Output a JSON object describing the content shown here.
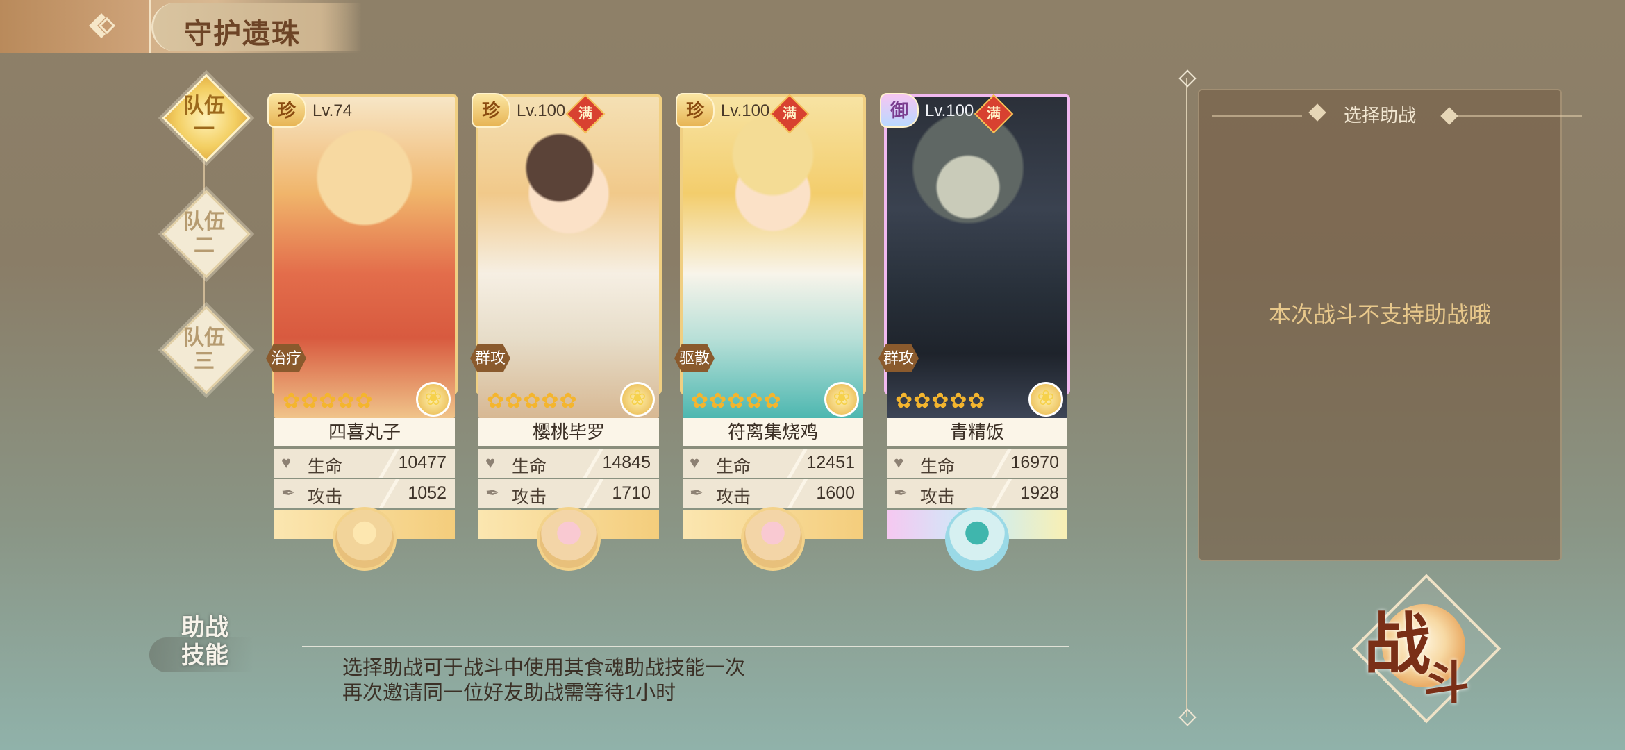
{
  "header": {
    "title": "守护遗珠"
  },
  "teams": [
    {
      "line1": "队伍",
      "line2": "一",
      "active": true
    },
    {
      "line1": "队伍",
      "line2": "二",
      "active": false
    },
    {
      "line1": "队伍",
      "line2": "三",
      "active": false
    }
  ],
  "cards": [
    {
      "rarity": "珍",
      "level": "Lv.74",
      "max_badge": "",
      "role": "治疗",
      "name": "四喜丸子",
      "hp_label": "生命",
      "hp": "10477",
      "atk_label": "攻击",
      "atk": "1052"
    },
    {
      "rarity": "珍",
      "level": "Lv.100",
      "max_badge": "满",
      "role": "群攻",
      "name": "樱桃毕罗",
      "hp_label": "生命",
      "hp": "14845",
      "atk_label": "攻击",
      "atk": "1710"
    },
    {
      "rarity": "珍",
      "level": "Lv.100",
      "max_badge": "满",
      "role": "驱散",
      "name": "符离集烧鸡",
      "hp_label": "生命",
      "hp": "12451",
      "atk_label": "攻击",
      "atk": "1600"
    },
    {
      "rarity": "御",
      "level": "Lv.100",
      "max_badge": "满",
      "role": "群攻",
      "name": "青精饭",
      "hp_label": "生命",
      "hp": "16970",
      "atk_label": "攻击",
      "atk": "1928"
    }
  ],
  "helper": {
    "title": "选择助战",
    "message": "本次战斗不支持助战哦"
  },
  "skill": {
    "heading_line1": "助战",
    "heading_line2": "技能",
    "line1": "选择助战可于战斗中使用其食魂助战技能一次",
    "line2": "再次邀请同一位好友助战需等待1小时"
  },
  "battle": {
    "char1": "战",
    "char2": "斗"
  },
  "colors": {
    "accent_gold": "#f0cf82",
    "panel_brown": "#78624a",
    "helper_text": "#e8c88b"
  }
}
